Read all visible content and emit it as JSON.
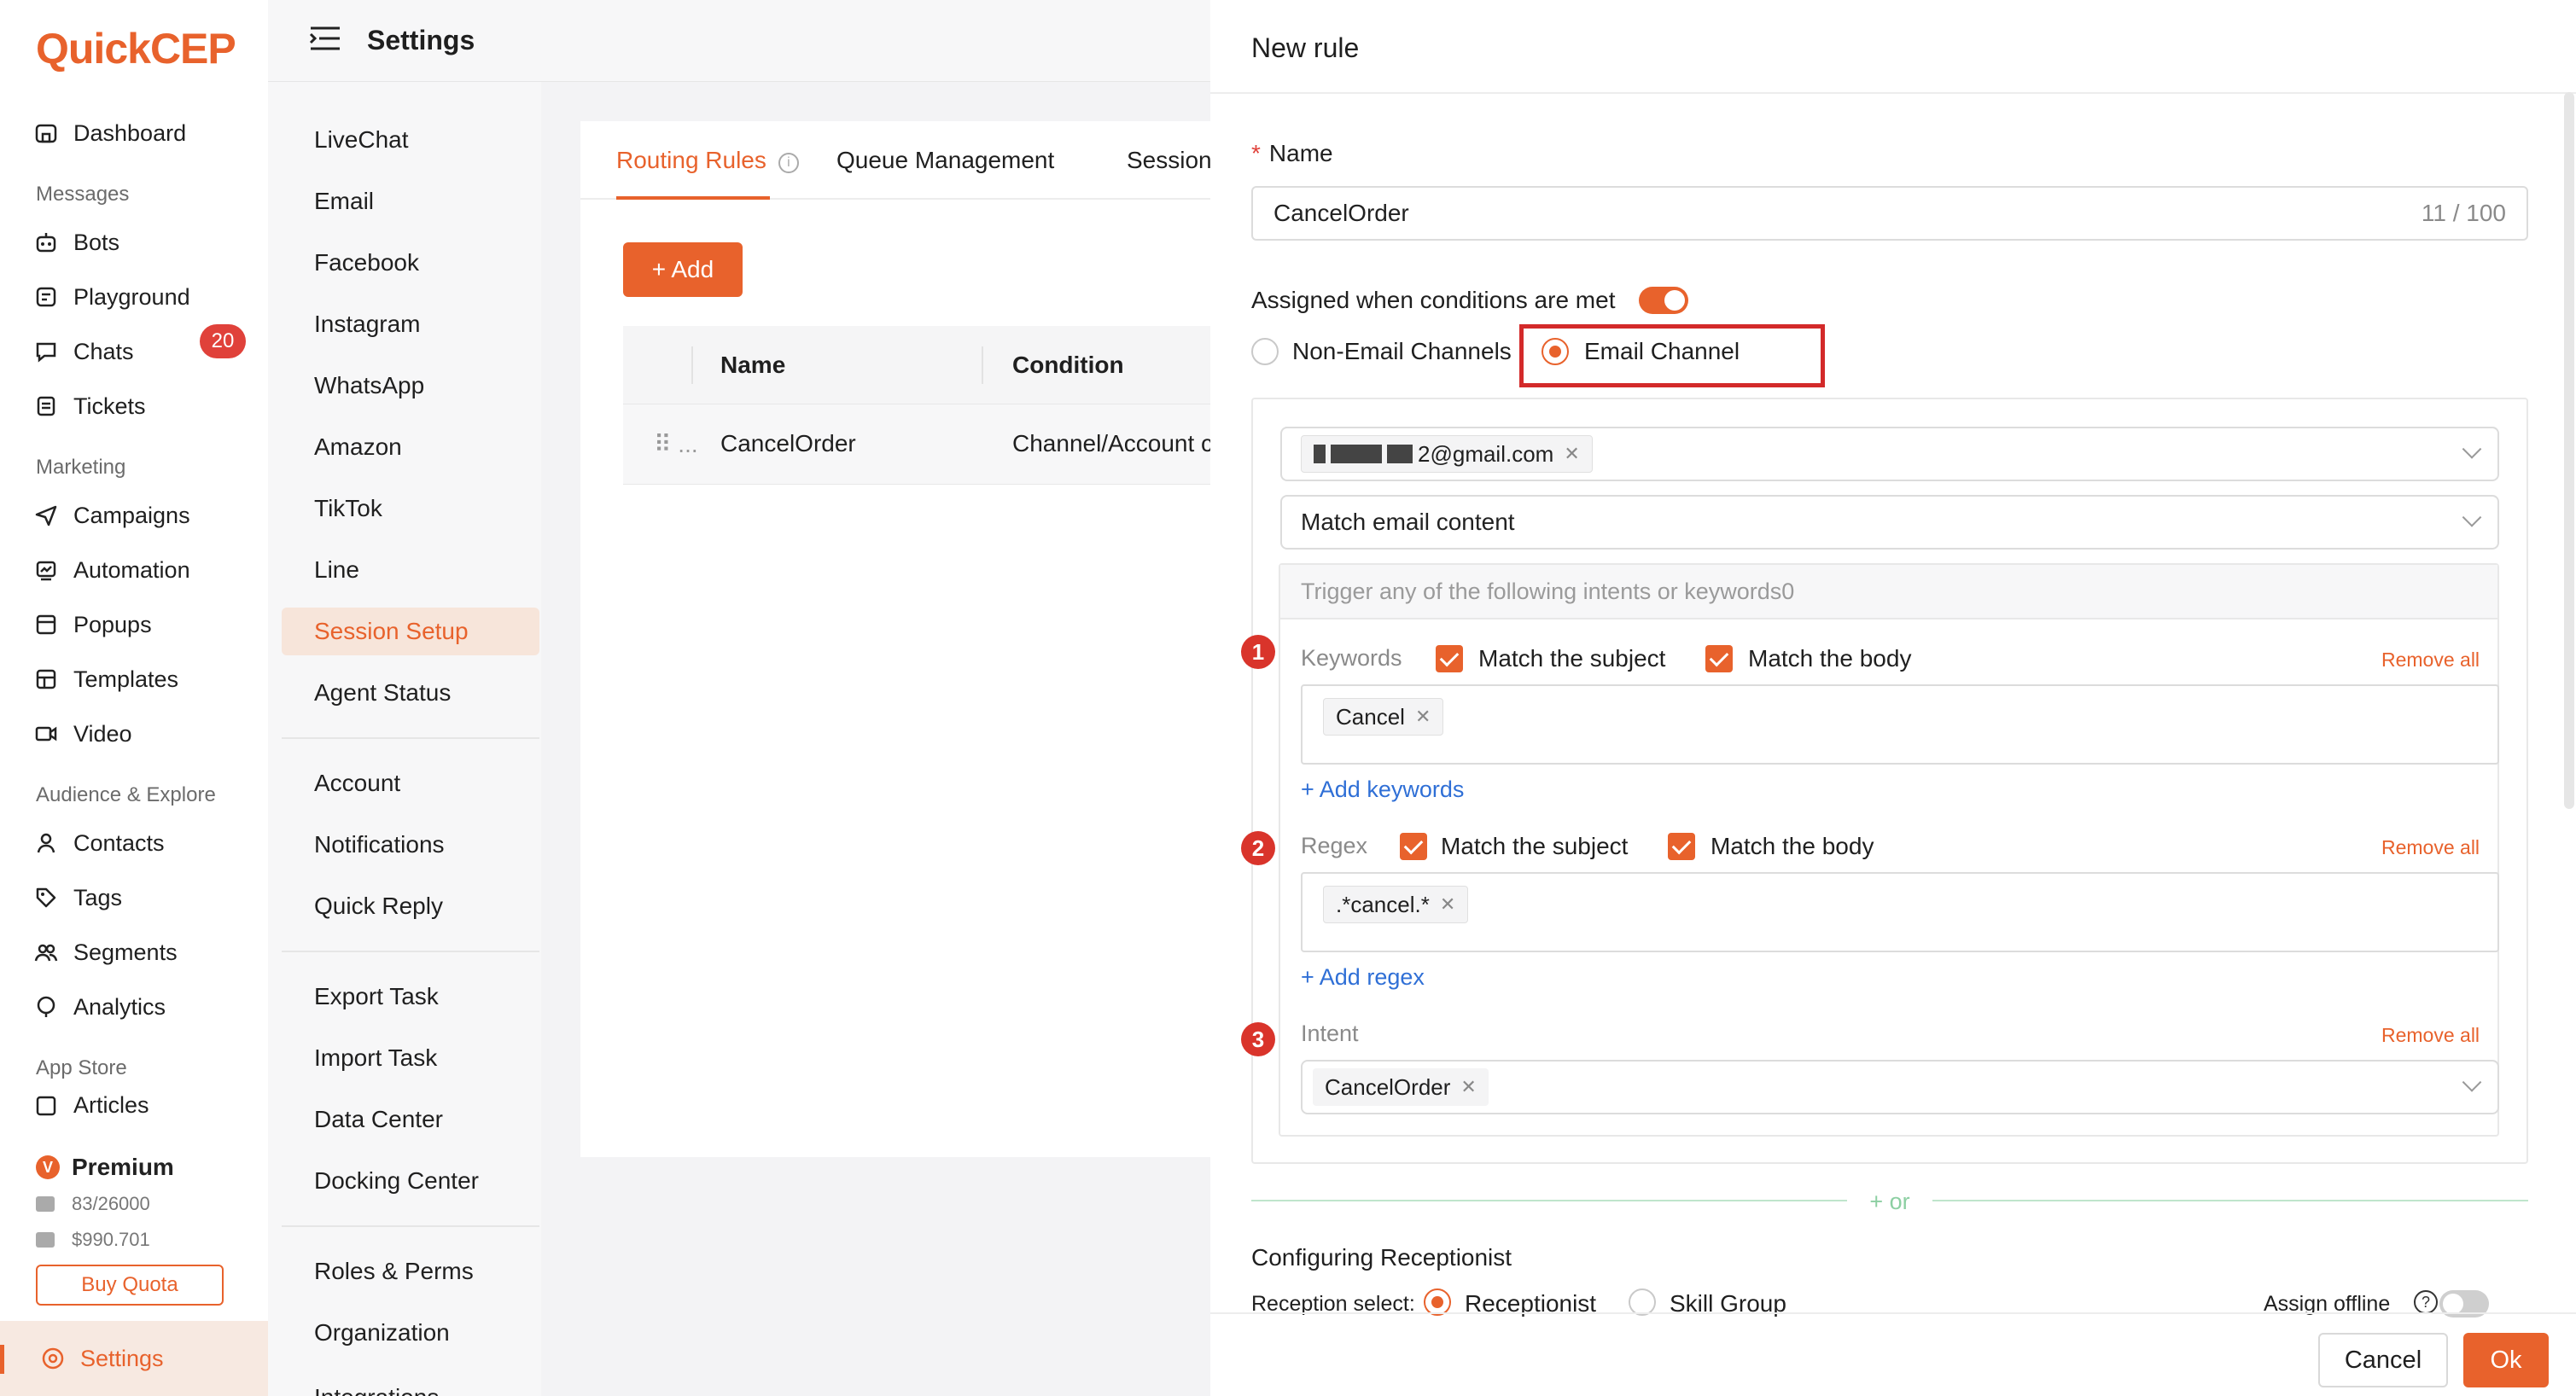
{
  "app": {
    "logo": "QuickCEP",
    "header_title": "Settings"
  },
  "nav": {
    "dashboard": "Dashboard",
    "section_messages": "Messages",
    "bots": "Bots",
    "playground": "Playground",
    "chats": "Chats",
    "chats_badge": "20",
    "tickets": "Tickets",
    "section_marketing": "Marketing",
    "campaigns": "Campaigns",
    "automation": "Automation",
    "popups": "Popups",
    "templates": "Templates",
    "video": "Video",
    "section_audience": "Audience & Explore",
    "contacts": "Contacts",
    "tags": "Tags",
    "segments": "Segments",
    "analytics": "Analytics",
    "section_appstore": "App Store",
    "articles": "Articles",
    "premium": "Premium",
    "premium_badge": "V",
    "quota_count": "83/26000",
    "quota_money": "$990.701",
    "buy_quota": "Buy Quota",
    "settings": "Settings"
  },
  "submenu": {
    "livechat": "LiveChat",
    "email": "Email",
    "facebook": "Facebook",
    "instagram": "Instagram",
    "whatsapp": "WhatsApp",
    "amazon": "Amazon",
    "tiktok": "TikTok",
    "line": "Line",
    "session_setup": "Session Setup",
    "agent_status": "Agent Status",
    "account": "Account",
    "notifications": "Notifications",
    "quick_reply": "Quick Reply",
    "export_task": "Export Task",
    "import_task": "Import Task",
    "data_center": "Data Center",
    "docking_center": "Docking Center",
    "roles_perms": "Roles & Perms",
    "organization": "Organization",
    "integrations": "Integrations"
  },
  "main": {
    "tabs": [
      "Routing Rules",
      "Queue Management",
      "Session"
    ],
    "add_button": "+ Add",
    "columns": [
      "Name",
      "Condition"
    ],
    "rows": [
      {
        "handle": "⠿ ...",
        "name": "CancelOrder",
        "condition": "Channel/Account c"
      }
    ]
  },
  "drawer": {
    "title": "New rule",
    "name_label": "Name",
    "name_value": "CancelOrder",
    "name_count": "11 / 100",
    "assigned_label": "Assigned when conditions are met",
    "channel_options": [
      "Non-Email Channels",
      "Email Channel"
    ],
    "account_tag_suffix": "2@gmail.com",
    "match_select": "Match email content",
    "trigger_header": "Trigger any of the following intents or keywords0",
    "keywords": {
      "num": "1",
      "label": "Keywords",
      "match_subject": "Match the subject",
      "match_body": "Match the body",
      "remove_all": "Remove all",
      "tag": "Cancel",
      "add_link": "+ Add keywords"
    },
    "regex": {
      "num": "2",
      "label": "Regex",
      "match_subject": "Match the subject",
      "match_body": "Match the body",
      "remove_all": "Remove all",
      "tag": ".*cancel.*",
      "add_link": "+ Add regex"
    },
    "intent": {
      "num": "3",
      "label": "Intent",
      "remove_all": "Remove all",
      "tag": "CancelOrder"
    },
    "or_button": "+ or",
    "receptionist_title": "Configuring Receptionist",
    "reception_select_label": "Reception select:",
    "reception_options": [
      "Receptionist",
      "Skill Group"
    ],
    "assign_offline": "Assign offline",
    "help_glyph": "?",
    "cancel_button": "Cancel",
    "ok_button": "Ok"
  },
  "colors": {
    "accent": "#e8622c",
    "highlight": "#d32a2a",
    "badge": "#e0413a",
    "link": "#2f6fd6"
  }
}
